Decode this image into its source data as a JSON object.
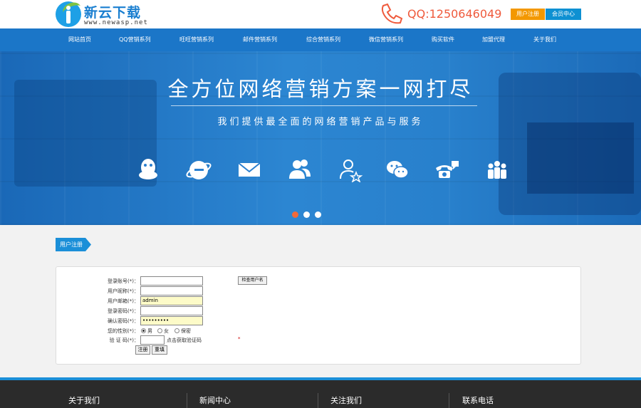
{
  "header": {
    "logo_title": "新云下载",
    "logo_subtitle": "www.newasp.net",
    "qq_text": "QQ:1250646049",
    "register_btn": "用户注册",
    "member_btn": "会员中心"
  },
  "nav": {
    "items": [
      "网站首页",
      "QQ营销系列",
      "旺旺营销系列",
      "邮件营销系列",
      "综合营销系列",
      "微信营销系列",
      "购买软件",
      "加盟代理",
      "关于我们"
    ]
  },
  "banner": {
    "title": "全方位网络营销方案一网打尽",
    "subtitle": "我们提供最全面的网络营销产品与服务",
    "icons": [
      "qq-icon",
      "browser-icon",
      "mail-icon",
      "users-icon",
      "user-star-icon",
      "wechat-icon",
      "telephone-icon",
      "group-icon"
    ],
    "slides": 3,
    "active_slide": 1
  },
  "section_tag": "用户注册",
  "form": {
    "labels": {
      "account": "登录账号(*)：",
      "nickname": "用户昵称(*)：",
      "email": "用户邮箱(*)：",
      "password": "登录密码(*)：",
      "confirm": "确认密码(*)：",
      "gender": "您的性别(*)：",
      "captcha": "验 证 码(*)："
    },
    "values": {
      "account": "",
      "nickname": "",
      "email": "admin",
      "password": "",
      "confirm": "•••••••••",
      "captcha": ""
    },
    "gender_options": [
      "男",
      "女",
      "保密"
    ],
    "gender_selected": "男",
    "captcha_hint": "点击获取验证码",
    "check_button": "检查用户名",
    "submit_button": "注册",
    "reset_button": "重填",
    "red_mark": "*"
  },
  "footer": {
    "columns": [
      "关于我们",
      "新闻中心",
      "关注我们",
      "联系电话"
    ]
  },
  "colors": {
    "nav_blue": "#1b76c8",
    "accent_orange": "#f39800",
    "qq_red": "#ef5a3c",
    "footer_dark": "#2b2b2b"
  }
}
